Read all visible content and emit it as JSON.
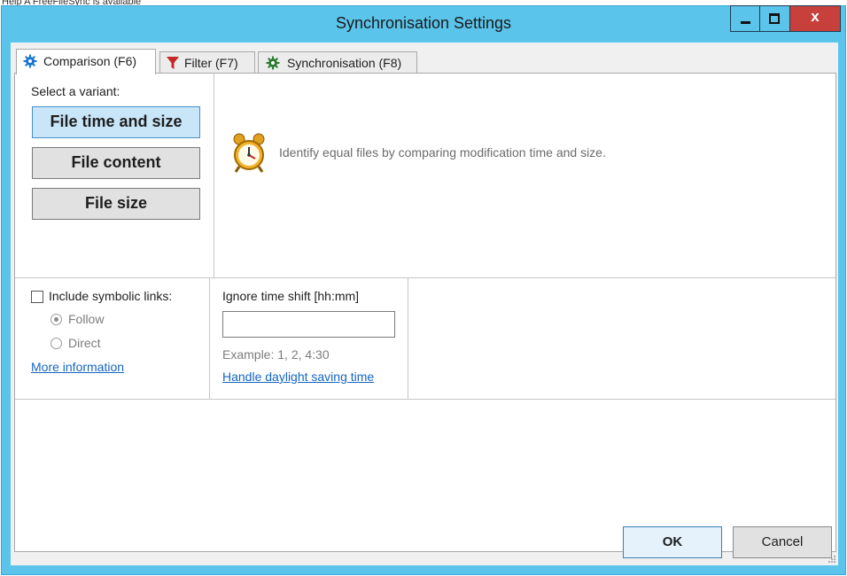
{
  "background_hint": "Help    A FreeFileSync is available",
  "window": {
    "title": "Synchronisation Settings",
    "close_glyph": "x"
  },
  "tabs": [
    {
      "label": "Comparison (F6)",
      "icon": "gear-icon",
      "active": true
    },
    {
      "label": "Filter (F7)",
      "icon": "funnel-icon",
      "active": false
    },
    {
      "label": "Synchronisation (F8)",
      "icon": "gear-green-icon",
      "active": false
    }
  ],
  "comparison": {
    "select_label": "Select a variant:",
    "variants": [
      {
        "label": "File time and size",
        "selected": true
      },
      {
        "label": "File content",
        "selected": false
      },
      {
        "label": "File size",
        "selected": false
      }
    ],
    "description": "Identify equal files by comparing modification time and size.",
    "description_icon": "alarm-clock-icon",
    "symlinks": {
      "checkbox_label": "Include symbolic links:",
      "checked": false,
      "options": [
        {
          "label": "Follow",
          "checked": true
        },
        {
          "label": "Direct",
          "checked": false
        }
      ],
      "more_info_link": "More information"
    },
    "time_shift": {
      "label": "Ignore time shift [hh:mm]",
      "value": "",
      "example": "Example:  1, 2, 4:30",
      "daylight_link": "Handle daylight saving time"
    }
  },
  "footer": {
    "ok_label": "OK",
    "cancel_label": "Cancel"
  },
  "colors": {
    "title_bar": "#5bc4ea",
    "close_button": "#c7403b",
    "selected_variant": "#c8e6f8",
    "link": "#1565c0",
    "filter_icon": "#c62828",
    "sync_icon": "#2e7d32",
    "comparison_icon": "#1976d2"
  }
}
